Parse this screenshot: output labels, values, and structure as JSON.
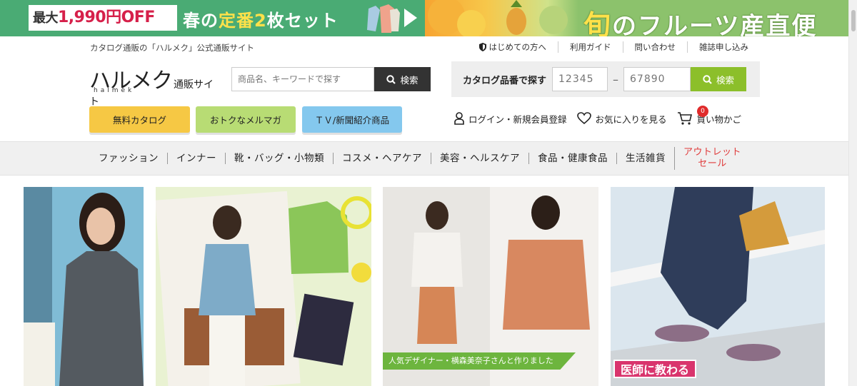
{
  "promo": {
    "left": {
      "prefix": "最大",
      "discount": "1,990円OFF",
      "text_a": "春の",
      "text_b": "定番",
      "text_c": "2",
      "text_d": "枚セット"
    },
    "right": {
      "title_a": "旬",
      "title_b": "のフルーツ産直便"
    }
  },
  "header": {
    "tagline": "カタログ通販の「ハルメク」公式通販サイト",
    "utility_links": [
      {
        "label": "はじめての方へ",
        "icon": "leaf-shield-icon"
      },
      {
        "label": "利用ガイド"
      },
      {
        "label": "問い合わせ"
      },
      {
        "label": "雑誌申し込み"
      }
    ],
    "logo": {
      "main": "ハルメク",
      "sub": "通販サイト",
      "roman": "halmek"
    },
    "search": {
      "placeholder": "商品名、キーワードで探す",
      "button_label": "検索"
    },
    "catalog_search": {
      "label": "カタログ品番で探す",
      "placeholder1": "12345",
      "placeholder2": "67890",
      "separator": "–",
      "button_label": "検索"
    },
    "pill_buttons": [
      {
        "label": "無料カタログ",
        "color": "#f6c844"
      },
      {
        "label": "おトクなメルマガ",
        "color": "#b8dc74"
      },
      {
        "label": "ＴＶ/新聞紹介商品",
        "color": "#84c8ee"
      }
    ],
    "account": {
      "login": "ログイン・新規会員登録",
      "favorites": "お気に入りを見る",
      "cart": "買い物かご",
      "cart_count": "0"
    }
  },
  "categories": [
    "ファッション",
    "インナー",
    "靴・バッグ・小物類",
    "コスメ・ヘアケア",
    "美容・ヘルスケア",
    "食品・健康食品",
    "生活雑貨"
  ],
  "outlet": {
    "line1": "アウトレット",
    "line2": "セール"
  },
  "cards": {
    "card3_caption": "人気デザイナー・横森美奈子さんと作りました",
    "card4_caption": "医師に教わる"
  },
  "colors": {
    "promo_green": "#4aab74",
    "fruit_green": "#8cc26c",
    "search_dark": "#333333",
    "catalog_green": "#8cbf2a",
    "outlet_red": "#e03a3a",
    "cart_badge": "#e02b2b"
  }
}
